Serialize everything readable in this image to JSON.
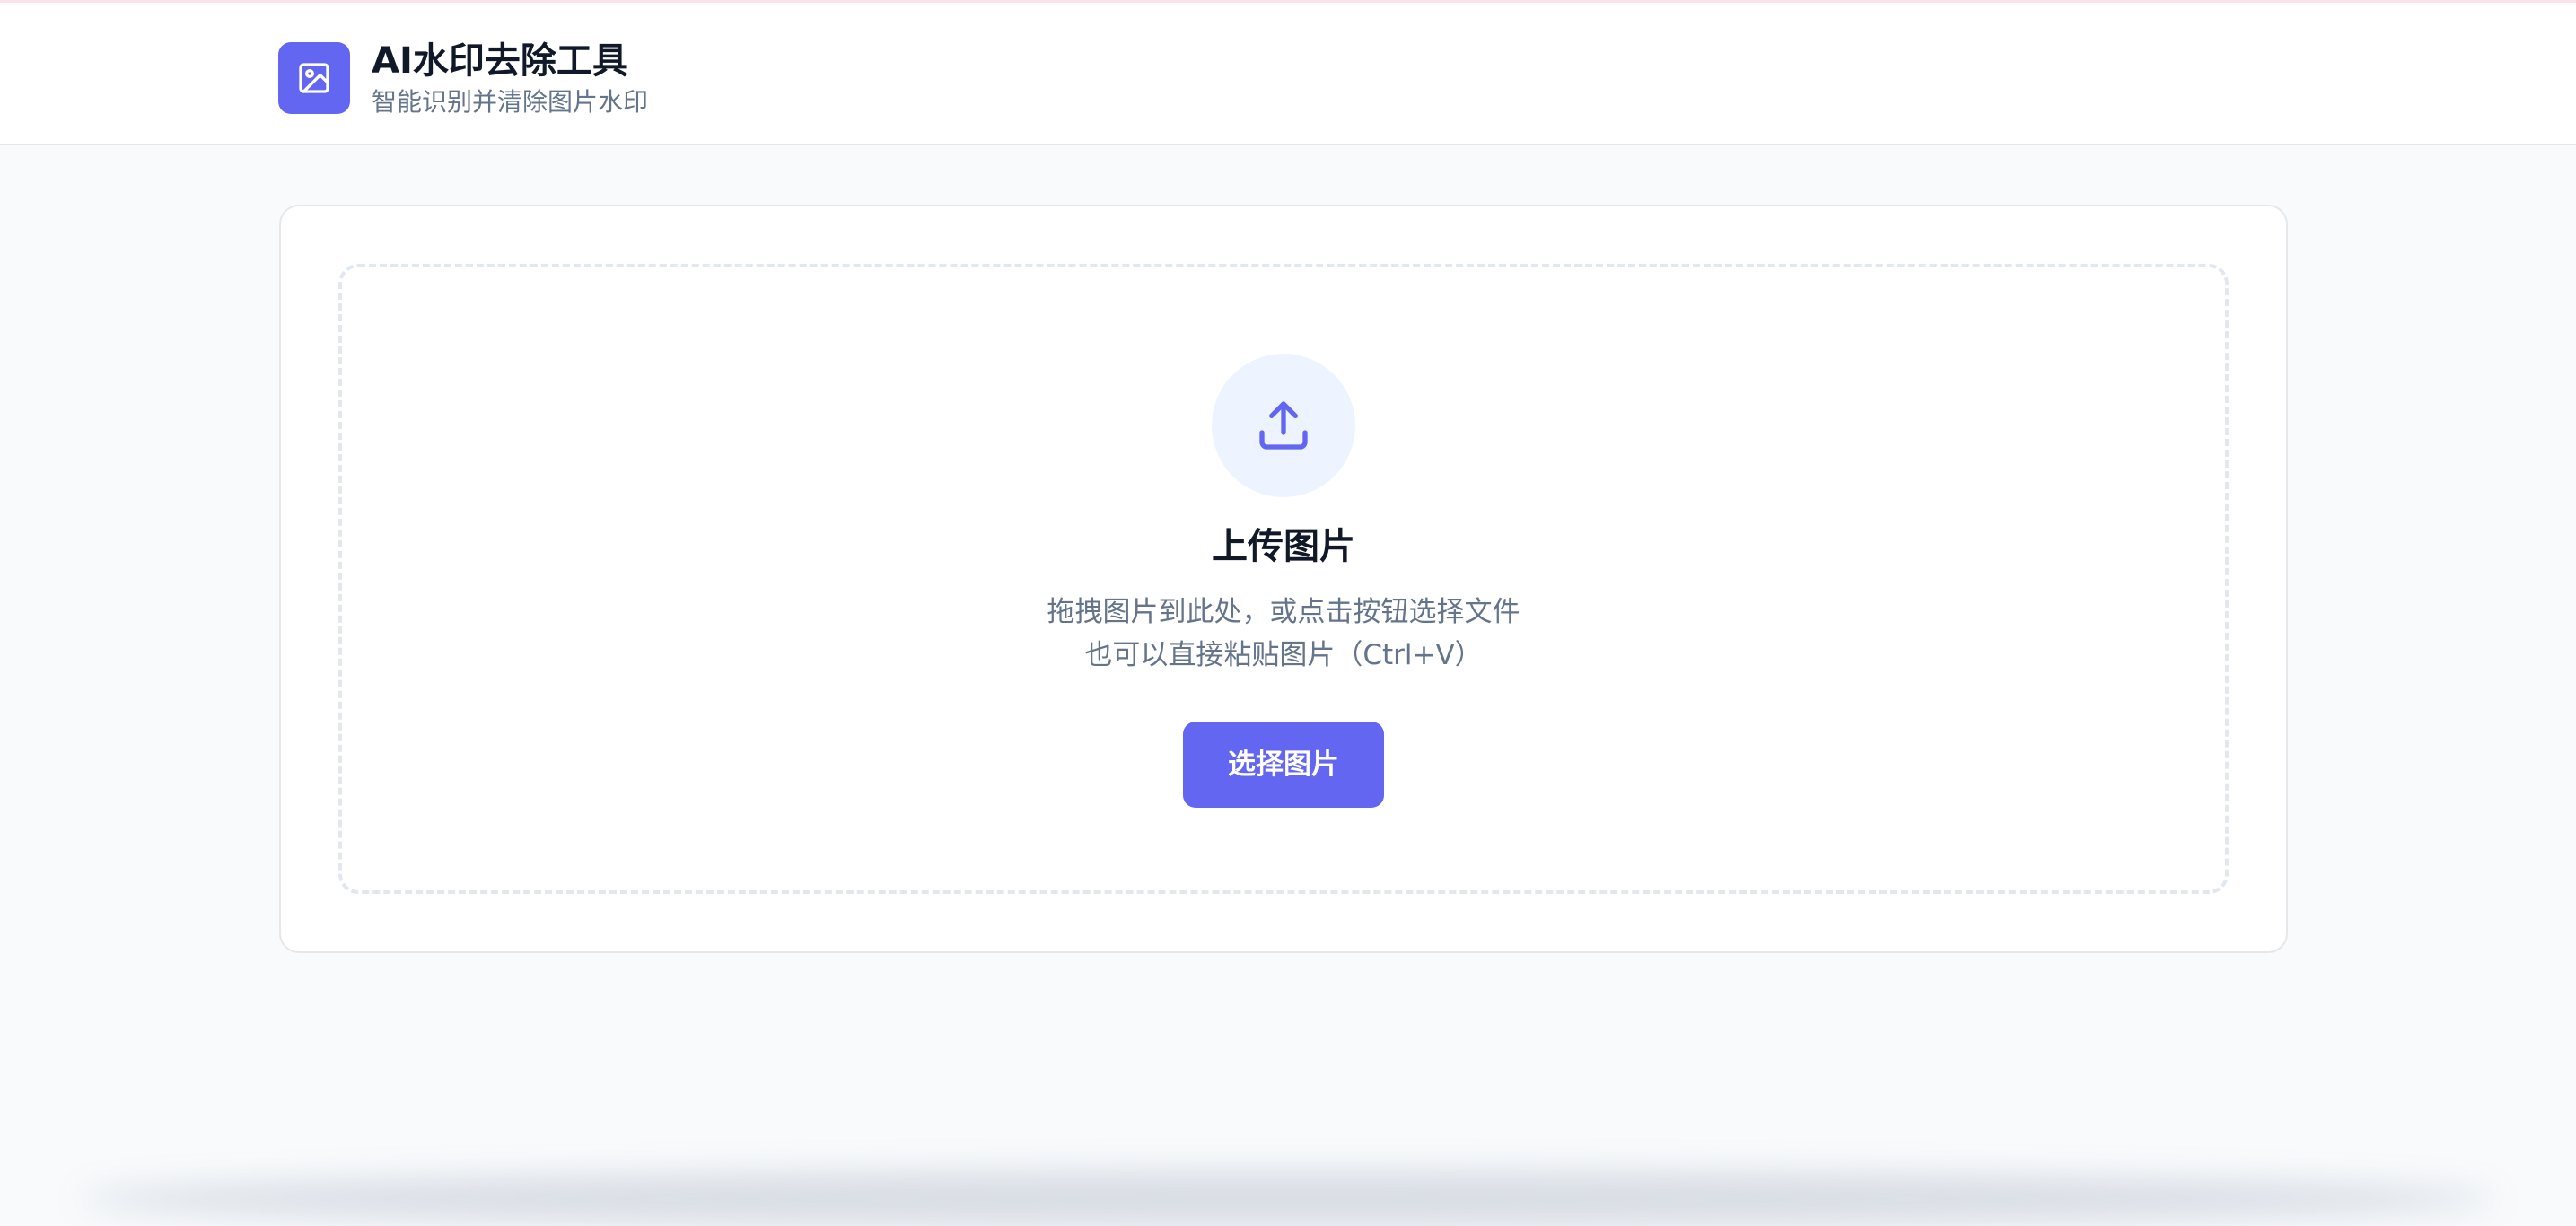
{
  "header": {
    "title": "AI水印去除工具",
    "subtitle": "智能识别并清除图片水印",
    "logo_icon": "image-icon"
  },
  "upload": {
    "icon": "upload-icon",
    "title": "上传图片",
    "description_line1": "拖拽图片到此处，或点击按钮选择文件",
    "description_line2": "也可以直接粘贴图片（Ctrl+V）",
    "button_label": "选择图片"
  },
  "colors": {
    "accent": "#6366f1",
    "background": "#f8fafc",
    "card": "#ffffff",
    "text_primary": "#111827",
    "text_secondary": "#64748b",
    "icon_bg": "#eef4ff",
    "border": "#e5e7eb"
  }
}
